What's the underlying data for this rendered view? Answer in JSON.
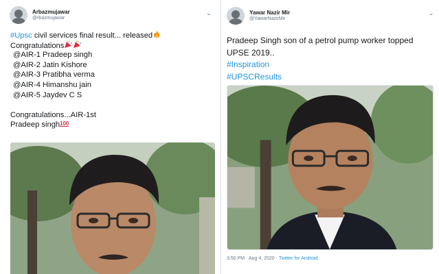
{
  "tweet_left": {
    "display_name": "Arbazmujawar",
    "handle": "@rbazmujawar",
    "line1_hashtag": "#Upsc",
    "line1_text": " civil services final result... released",
    "line2_text": "Congratulations",
    "ranks": [
      "@AIR-1 Pradeep singh",
      "@AIR-2 Jatin Kishore",
      "@AIR-3 Pratibha verma",
      "@AIR-4 Himanshu jain",
      "@AIR-5 Jaydev C S"
    ],
    "line8_text": "Congratulations...AIR-1st",
    "line9_text": "Pradeep singh",
    "image_icon": "portrait-photo-icon"
  },
  "tweet_right": {
    "display_name": "Yawar Nazir Mir",
    "handle": "@YawarNazirMir",
    "line1_text": "Pradeep Singh son of a petrol pump worker topped",
    "line2_text": "UPSE 2019..",
    "hashtags": [
      "#Inspiration",
      "#UPSCResults"
    ],
    "time": "3:50 PM",
    "date": "Aug 4, 2020",
    "separator": "·",
    "app": "Twitter for Android",
    "image_icon": "portrait-photo-icon"
  },
  "colors": {
    "link": "#1b95e0",
    "text": "#14171a",
    "secondary": "#657786"
  },
  "icons": {
    "menu": "chevron-down-icon",
    "fire": "fire-emoji-icon",
    "party": "party-popper-emoji-icon",
    "hundred": "hundred-points-emoji-icon"
  }
}
